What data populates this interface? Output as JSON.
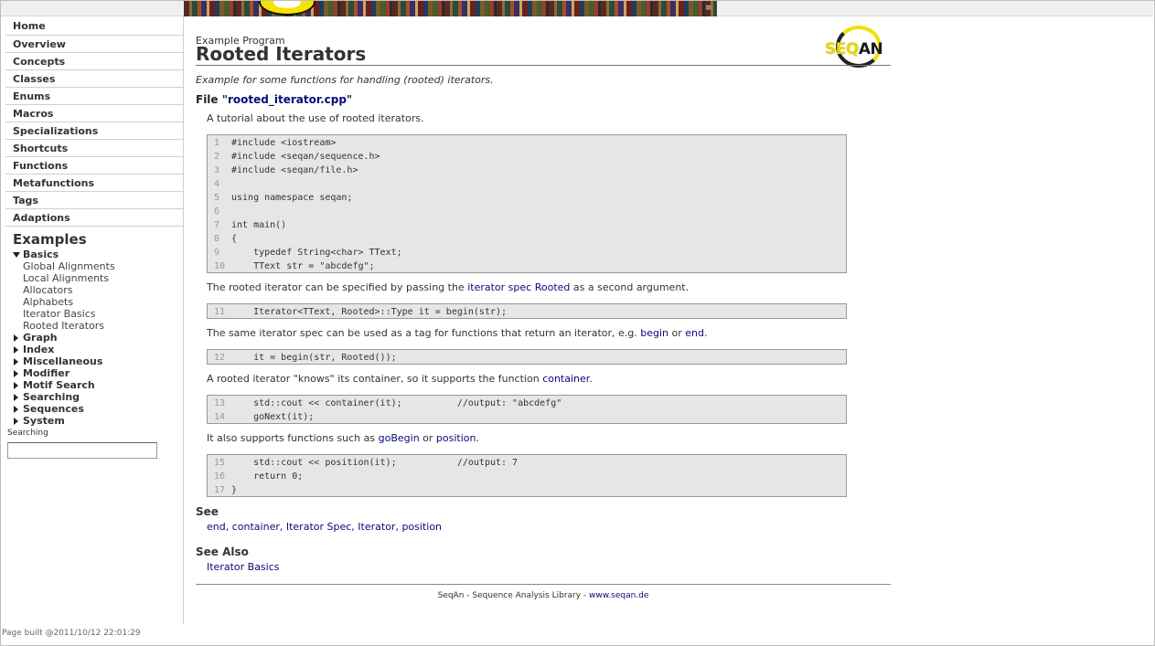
{
  "sidebar": {
    "nav": [
      "Home",
      "Overview",
      "Concepts",
      "Classes",
      "Enums",
      "Macros",
      "Specializations",
      "Shortcuts",
      "Functions",
      "Metafunctions",
      "Tags",
      "Adaptions"
    ],
    "examples_title": "Examples",
    "basics": {
      "label": "Basics",
      "items": [
        "Global Alignments",
        "Local Alignments",
        "Allocators",
        "Alphabets",
        "Iterator Basics",
        "Rooted Iterators"
      ]
    },
    "categories": [
      "Graph",
      "Index",
      "Miscellaneous",
      "Modifier",
      "Motif Search",
      "Searching",
      "Sequences",
      "System"
    ],
    "search_label": "Searching",
    "search_value": ""
  },
  "main": {
    "kind": "Example Program",
    "title": "Rooted Iterators",
    "logo_text_1": "SEQ",
    "logo_text_2": "AN",
    "summary": "Example for some functions for handling (rooted) iterators.",
    "file_prefix": "File \"",
    "file_name": "rooted_iterator.cpp",
    "file_suffix": "\"",
    "intro": "A tutorial about the use of rooted iterators.",
    "code1": [
      {
        "n": "1",
        "t": "#include <iostream>"
      },
      {
        "n": "2",
        "t": "#include <seqan/sequence.h>"
      },
      {
        "n": "3",
        "t": "#include <seqan/file.h>"
      },
      {
        "n": "4",
        "t": ""
      },
      {
        "n": "5",
        "t": "using namespace seqan;"
      },
      {
        "n": "6",
        "t": ""
      },
      {
        "n": "7",
        "t": "int main()"
      },
      {
        "n": "8",
        "t": "{"
      },
      {
        "n": "9",
        "t": "    typedef String<char> TText;"
      },
      {
        "n": "10",
        "t": "    TText str = \"abcdefg\";"
      }
    ],
    "text2": {
      "a": "The rooted iterator can be specified by passing the ",
      "link": "iterator spec Rooted",
      "b": " as a second argument."
    },
    "code2": [
      {
        "n": "11",
        "t": "    Iterator<TText, Rooted>::Type it = begin(str);"
      }
    ],
    "text3": {
      "a": "The same iterator spec can be used as a tag for functions that return an iterator, e.g. ",
      "link1": "begin",
      "mid": " or ",
      "link2": "end",
      "b": "."
    },
    "code3": [
      {
        "n": "12",
        "t": "    it = begin(str, Rooted());"
      }
    ],
    "text4": {
      "a": "A rooted iterator \"knows\" its container, so it supports the function ",
      "link": "container",
      "b": "."
    },
    "code4": [
      {
        "n": "13",
        "t": "    std::cout << container(it);          //output: \"abcdefg\""
      },
      {
        "n": "14",
        "t": "    goNext(it);"
      }
    ],
    "text5": {
      "a": "It also supports functions such as ",
      "link1": "goBegin",
      "mid": " or ",
      "link2": "position",
      "b": "."
    },
    "code5": [
      {
        "n": "15",
        "t": "    std::cout << position(it);           //output: 7"
      },
      {
        "n": "16",
        "t": "    return 0;"
      },
      {
        "n": "17",
        "t": "}"
      }
    ],
    "see_heading": "See",
    "see_links": [
      "end",
      "container",
      "Iterator Spec",
      "Iterator",
      "position"
    ],
    "see_sep": ", ",
    "see_also_heading": "See Also",
    "see_also_links": [
      "Iterator Basics"
    ],
    "footer_text": "SeqAn - Sequence Analysis Library - ",
    "footer_link": "www.seqan.de"
  },
  "page_built": "Page built @2011/10/12 22:01:29",
  "colors": {
    "link": "#0a0a7a",
    "code_bg": "#e6e6e6"
  }
}
